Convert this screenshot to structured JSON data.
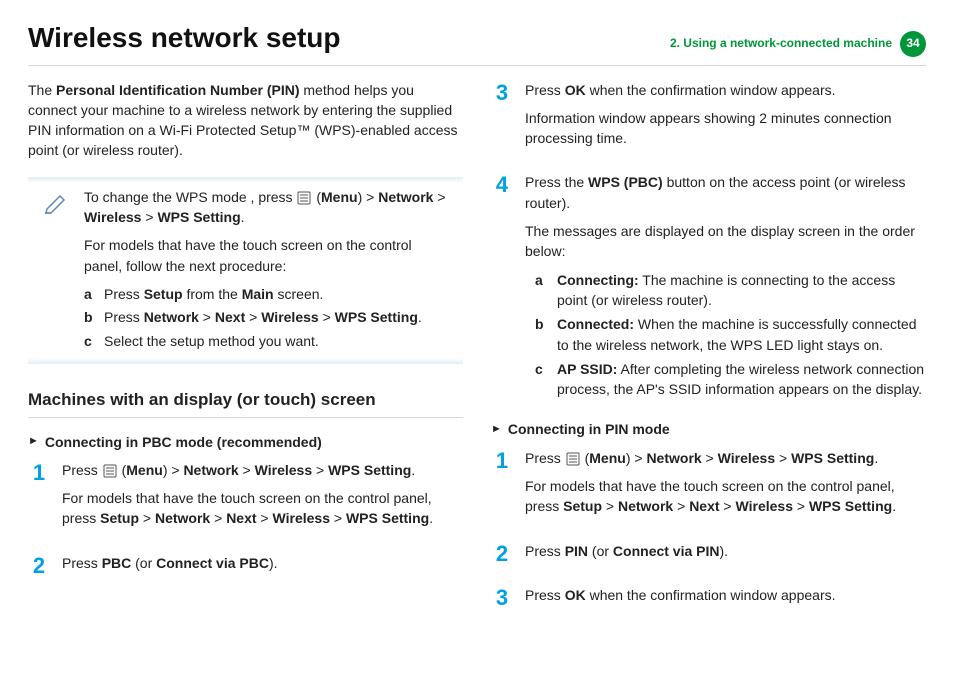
{
  "header": {
    "title": "Wireless network setup",
    "chapter": "2.  Using a network-connected machine",
    "page": "34"
  },
  "intro": {
    "p1a": "The ",
    "p1b": "Personal Identification Number (PIN)",
    "p1c": " method helps you connect your machine to a wireless network by entering the supplied PIN information on a Wi-Fi Protected Setup™ (WPS)-enabled access point (or wireless router)."
  },
  "note": {
    "l1a": "To change  the WPS mode , press ",
    "l1b": " (",
    "l1c": "Menu",
    "l1d": ") > ",
    "l1e": "Network",
    "l1f": " > ",
    "l1g": "Wireless",
    "l1h": " > ",
    "l1i": "WPS Setting",
    "l1j": ".",
    "l2": "For models that have the touch screen on the control panel, follow the next procedure:",
    "a_a": "Press ",
    "a_b": "Setup",
    "a_c": " from the ",
    "a_d": "Main",
    "a_e": " screen.",
    "b_a": "Press ",
    "b_b": "Network",
    "b_c": " > ",
    "b_d": "Next",
    "b_e": " > ",
    "b_f": "Wireless",
    "b_g": " > ",
    "b_h": "WPS Setting",
    "b_i": ".",
    "c": "Select the setup method you want."
  },
  "section1": "Machines with an display (or touch) screen",
  "sub1": "Connecting in PBC mode (recommended)",
  "left_step1": {
    "a1": "Press ",
    "a2": " (",
    "a3": "Menu",
    "a4": ") > ",
    "a5": "Network",
    "a6": "  > ",
    "a7": "Wireless",
    "a8": " > ",
    "a9": "WPS Setting",
    "a10": ".",
    "b1": "For models that have the touch screen on the control panel, press ",
    "b2": "Setup",
    "b3": " > ",
    "b4": "Network",
    "b5": " > ",
    "b6": "Next",
    "b7": " > ",
    "b8": "Wireless",
    "b9": " > ",
    "b10": "WPS Setting",
    "b11": "."
  },
  "left_step2": {
    "a": "Press ",
    "b": "PBC",
    "c": " (or ",
    "d": "Connect via PBC",
    "e": ")."
  },
  "right_step3": {
    "a": "Press ",
    "b": "OK",
    "c": " when the confirmation window appears.",
    "p2": "Information window appears showing 2 minutes connection processing time."
  },
  "right_step4": {
    "a1": "Press the ",
    "a2": "WPS (PBC)",
    "a3": " button on the access point (or wireless router).",
    "p2": "The messages are displayed on the display screen in the order below:",
    "sa_b": "Connecting:",
    "sa_t": " The machine is connecting to the access point (or wireless router).",
    "sb_b": "Connected:",
    "sb_t": " When the machine is successfully connected to the wireless network, the WPS LED light stays on.",
    "sc_b": "AP SSID:",
    "sc_t": " After completing the wireless network connection process, the AP's SSID information appears on the display."
  },
  "sub2": "Connecting in PIN mode",
  "right_b_step1": {
    "a1": "Press ",
    "a2": " (",
    "a3": "Menu",
    "a4": ") > ",
    "a5": "Network",
    "a6": "  > ",
    "a7": "Wireless",
    "a8": " > ",
    "a9": "WPS Setting",
    "a10": ".",
    "b1": "For models that have the touch screen on the control panel, press ",
    "b2": "Setup",
    "b3": " > ",
    "b4": "Network",
    "b5": " > ",
    "b6": "Next",
    "b7": " > ",
    "b8": "Wireless",
    "b9": " > ",
    "b10": "WPS Setting",
    "b11": "."
  },
  "right_b_step2": {
    "a": "Press ",
    "b": "PIN",
    "c": " (or ",
    "d": "Connect via PIN",
    "e": ")."
  },
  "right_b_step3": {
    "a": "Press ",
    "b": "OK",
    "c": " when the confirmation window appears."
  },
  "letters": {
    "a": "a",
    "b": "b",
    "c": "c"
  },
  "nums": {
    "n1": "1",
    "n2": "2",
    "n3": "3",
    "n4": "4"
  },
  "tri": "►"
}
